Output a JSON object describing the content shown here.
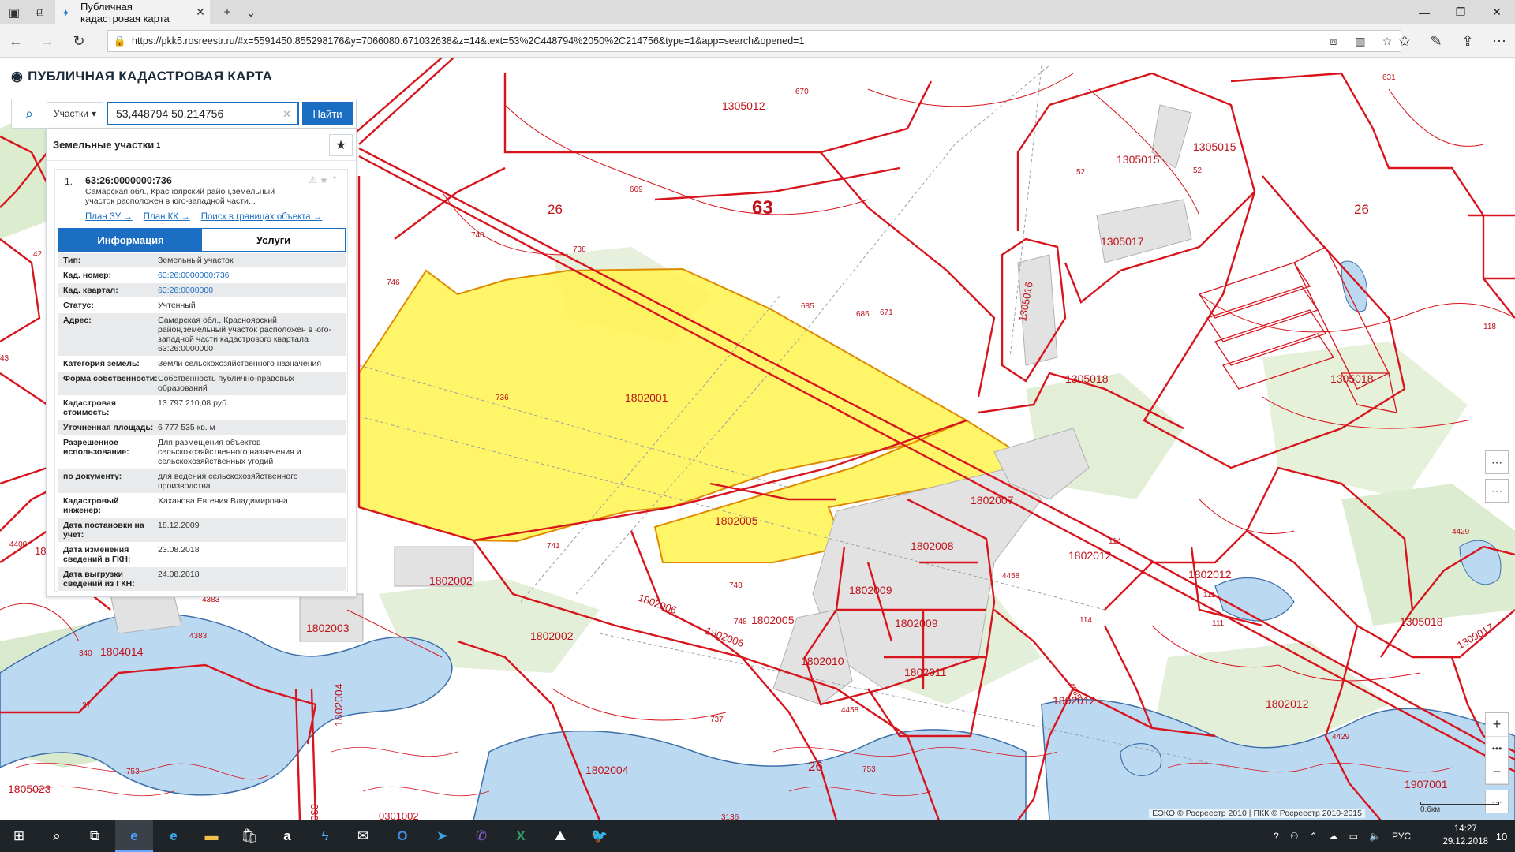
{
  "browser": {
    "tab_title": "Публичная кадастровая карта",
    "url": "https://pkk5.rosreestr.ru/#x=5591450.855298176&y=7066080.671032638&z=14&text=53%2C448794%2050%2C214756&type=1&app=search&opened=1"
  },
  "app": {
    "title": "ПУБЛИЧНАЯ КАДАСТРОВАЯ КАРТА",
    "search": {
      "type_select": "Участки",
      "query": "53,448794 50,214756",
      "button": "Найти"
    },
    "results": {
      "header": "Земельные участки",
      "count": "1",
      "item": {
        "index": "1.",
        "cad_number": "63:26:0000000:736",
        "short_desc": "Самарская обл., Красноярский район,земельный участок расположен в юго-западной части...",
        "links": [
          "План ЗУ →",
          "План КК →",
          "Поиск в границах объекта →"
        ],
        "tabs": [
          "Информация",
          "Услуги"
        ],
        "fields": [
          {
            "k": "Тип:",
            "v": "Земельный участок"
          },
          {
            "k": "Кад. номер:",
            "v": "63:26:0000000:736",
            "link": true
          },
          {
            "k": "Кад. квартал:",
            "v": "63:26:0000000",
            "link": true
          },
          {
            "k": "Статус:",
            "v": "Учтенный"
          },
          {
            "k": "Адрес:",
            "v": "Самарская обл., Красноярский район,земельный участок расположен в юго-западной части кадастрового квартала 63:26:0000000"
          },
          {
            "k": "Категория земель:",
            "v": "Земли сельскохозяйственного назначения"
          },
          {
            "k": "Форма собственности:",
            "v": "Собственность публично-правовых образований"
          },
          {
            "k": "Кадастровая стоимость:",
            "v": "13 797 210,08 руб."
          },
          {
            "k": "Уточненная площадь:",
            "v": "6 777 535 кв. м"
          },
          {
            "k": "Разрешенное использование:",
            "v": "Для размещения объектов сельскохозяйственного назначения и сельскохозяйственных угодий"
          },
          {
            "k": "по документу:",
            "v": "для ведения сельскохозяйственного производства"
          },
          {
            "k": "Кадастровый инженер:",
            "v": "Хаханова Евгения Владимировна"
          },
          {
            "k": "Дата постановки на учет:",
            "v": "18.12.2009"
          },
          {
            "k": "Дата изменения сведений в ГКН:",
            "v": "23.08.2018"
          },
          {
            "k": "Дата выгрузки сведений из ГКН:",
            "v": "24.08.2018"
          }
        ]
      }
    },
    "copyright": "ЕЭКО © Росреестр 2010 | ПКК © Росреестр 2010-2015",
    "scale_label": "0.6км"
  },
  "map_labels": [
    {
      "t": "1305012",
      "c": "red"
    },
    {
      "t": "670",
      "c": "red"
    },
    {
      "t": "631",
      "c": "red"
    },
    {
      "t": "1305015",
      "c": "red"
    },
    {
      "t": "52",
      "c": "red"
    },
    {
      "t": "1305015",
      "c": "red"
    },
    {
      "t": "52",
      "c": "red"
    },
    {
      "t": "63",
      "c": "big"
    },
    {
      "t": "26",
      "c": "big"
    },
    {
      "t": "26",
      "c": "big"
    },
    {
      "t": "669",
      "c": "red"
    },
    {
      "t": "1305017",
      "c": "red"
    },
    {
      "t": "740",
      "c": "red"
    },
    {
      "t": "738",
      "c": "red"
    },
    {
      "t": "746",
      "c": "red"
    },
    {
      "t": "685",
      "c": "red"
    },
    {
      "t": "686",
      "c": "red"
    },
    {
      "t": "671",
      "c": "red"
    },
    {
      "t": "1305016",
      "c": "red"
    },
    {
      "t": "1305018",
      "c": "red"
    },
    {
      "t": "1305018",
      "c": "red"
    },
    {
      "t": "118",
      "c": "red"
    },
    {
      "t": "736",
      "c": "red"
    },
    {
      "t": "1802001",
      "c": "red"
    },
    {
      "t": "1802005",
      "c": "red"
    },
    {
      "t": "1802007",
      "c": "red"
    },
    {
      "t": "1802008",
      "c": "red"
    },
    {
      "t": "114",
      "c": "red"
    },
    {
      "t": "1802012",
      "c": "red"
    },
    {
      "t": "4429",
      "c": "red"
    },
    {
      "t": "741",
      "c": "red"
    },
    {
      "t": "1802002",
      "c": "red"
    },
    {
      "t": "748",
      "c": "red"
    },
    {
      "t": "1802009",
      "c": "red"
    },
    {
      "t": "4458",
      "c": "red"
    },
    {
      "t": "1802012",
      "c": "red"
    },
    {
      "t": "111",
      "c": "red"
    },
    {
      "t": "1802006",
      "c": "red"
    },
    {
      "t": "748",
      "c": "red"
    },
    {
      "t": "1802005",
      "c": "red"
    },
    {
      "t": "1802009",
      "c": "red"
    },
    {
      "t": "114",
      "c": "red"
    },
    {
      "t": "111",
      "c": "red"
    },
    {
      "t": "1305018",
      "c": "red"
    },
    {
      "t": "1802003",
      "c": "red"
    },
    {
      "t": "1802002",
      "c": "red"
    },
    {
      "t": "1802006",
      "c": "red"
    },
    {
      "t": "4383",
      "c": "red"
    },
    {
      "t": "4383",
      "c": "red"
    },
    {
      "t": "1804014",
      "c": "red"
    },
    {
      "t": "340",
      "c": "red"
    },
    {
      "t": "1802010",
      "c": "red"
    },
    {
      "t": "1802011",
      "c": "red"
    },
    {
      "t": "4985",
      "c": "red"
    },
    {
      "t": "1802012",
      "c": "red"
    },
    {
      "t": "1802012",
      "c": "red"
    },
    {
      "t": "1309017",
      "c": "red"
    },
    {
      "t": "27",
      "c": "red"
    },
    {
      "t": "1802004",
      "c": "red"
    },
    {
      "t": "4458",
      "c": "red"
    },
    {
      "t": "737",
      "c": "red"
    },
    {
      "t": "4429",
      "c": "red"
    },
    {
      "t": "753",
      "c": "red"
    },
    {
      "t": "1802004",
      "c": "red"
    },
    {
      "t": "26",
      "c": "big"
    },
    {
      "t": "753",
      "c": "red"
    },
    {
      "t": "1907001",
      "c": "red"
    },
    {
      "t": "1805023",
      "c": "red"
    },
    {
      "t": "0301",
      "c": "red"
    },
    {
      "t": "0301002",
      "c": "red"
    },
    {
      "t": "3136",
      "c": "red"
    },
    {
      "t": "4400",
      "c": "red"
    },
    {
      "t": "18",
      "c": "red"
    },
    {
      "t": "42",
      "c": "red"
    },
    {
      "t": "43",
      "c": "red"
    }
  ],
  "taskbar": {
    "lang": "РУС",
    "time": "14:27",
    "date": "29.12.2018",
    "notif_count": "10"
  },
  "colors": {
    "parcel_line": "#d8141c",
    "selected_fill": "#fff34d",
    "accent": "#1b6ec2"
  }
}
